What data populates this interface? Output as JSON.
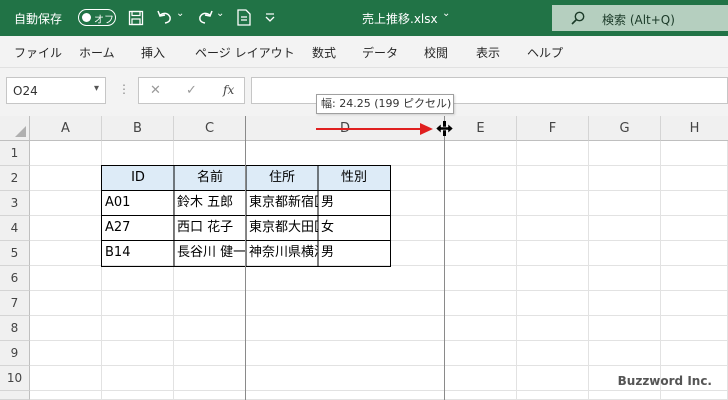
{
  "titlebar": {
    "autosave_label": "自動保存",
    "autosave_state": "オフ",
    "filename": "売上推移.xlsx",
    "chevron": "⌄",
    "search_label": "検索 (Alt+Q)"
  },
  "ribbon": {
    "tabs": [
      "ファイル",
      "ホーム",
      "挿入",
      "ページ レイアウト",
      "数式",
      "データ",
      "校閲",
      "表示",
      "ヘルプ"
    ]
  },
  "formula_bar": {
    "name_box": "O24",
    "fx": "fx",
    "content": ""
  },
  "sheet": {
    "columns": [
      "A",
      "B",
      "C",
      "D",
      "E",
      "F",
      "G",
      "H"
    ],
    "rows": [
      "1",
      "2",
      "3",
      "4",
      "5",
      "6",
      "7",
      "8",
      "9",
      "10"
    ],
    "table": {
      "headers": [
        "ID",
        "名前",
        "住所",
        "性別"
      ],
      "rows": [
        [
          "A01",
          "鈴木 五郎",
          "東京都新宿区",
          "男"
        ],
        [
          "A27",
          "西口 花子",
          "東京都大田区",
          "女"
        ],
        [
          "B14",
          "長谷川 健一",
          "神奈川県横浜市",
          "男"
        ]
      ]
    }
  },
  "resize_tooltip": "幅: 24.25 (199 ピクセル)",
  "watermark": "Buzzword Inc.",
  "colors": {
    "excel_green": "#217346",
    "header_fill": "#ddebf7",
    "arrow_red": "#e02020"
  }
}
